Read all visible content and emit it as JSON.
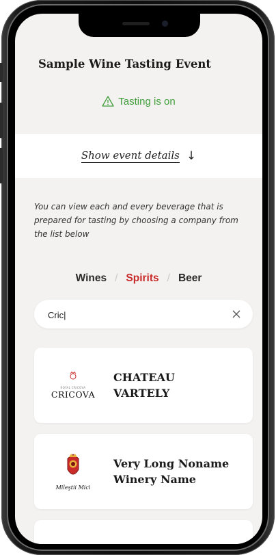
{
  "event": {
    "title": "Sample Wine Tasting Event",
    "status": "Tasting is on",
    "details_link": "Show event details",
    "details_arrow": "↓",
    "info_text": "You can view each and every beverage that is prepared for tasting by choosing a company from the list below"
  },
  "tabs": {
    "items": [
      "Wines",
      "Spirits",
      "Beer"
    ],
    "active": "Spirits",
    "separator": "/"
  },
  "search": {
    "value": "Cric|",
    "clear_icon": "close-icon"
  },
  "companies": [
    {
      "name_line1": "CHATEAU",
      "name_line2": "VARTELY",
      "logo_text": "CRICOVA",
      "logo_subtext": "ROYAL CRICOVA"
    },
    {
      "name_line1": "Very Long Noname",
      "name_line2": "Winery Name",
      "logo_text": "Mileştii Mici"
    }
  ],
  "colors": {
    "accent_red": "#c92a2a",
    "status_green": "#3f9d3a",
    "background": "#f3f2f0"
  }
}
